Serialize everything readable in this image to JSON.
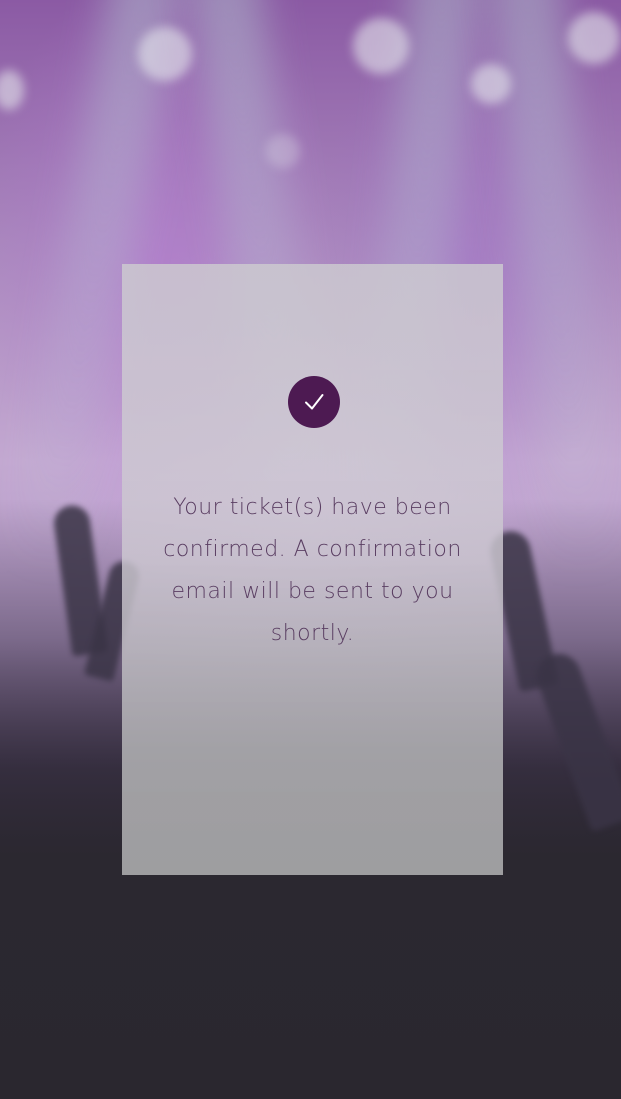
{
  "confirmation": {
    "message": "Your ticket(s) have been confirmed. A confirmation email will be sent to you shortly.",
    "icon": "check-icon"
  },
  "colors": {
    "badge": "#4d1a52",
    "message_text": "#5a3e62"
  }
}
